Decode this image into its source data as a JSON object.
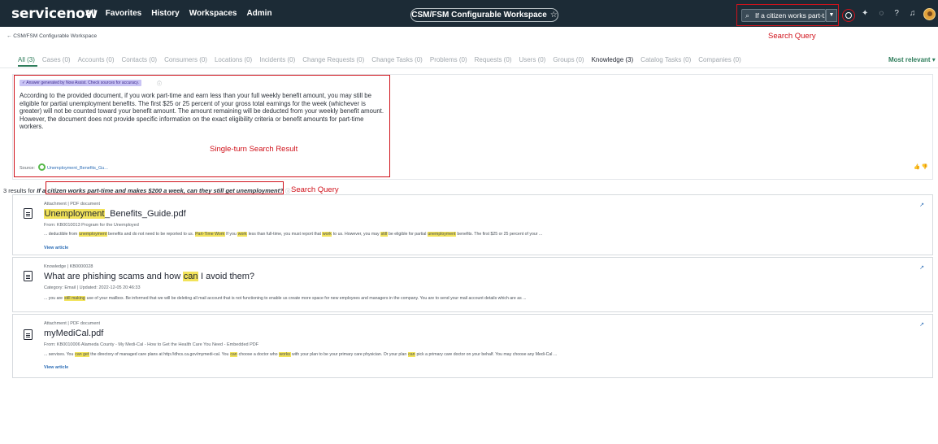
{
  "header": {
    "logo_text": "servicenow",
    "nav": [
      "All",
      "Favorites",
      "History",
      "Workspaces",
      "Admin"
    ],
    "workspace_label": "CSM/FSM Configurable Workspace",
    "workspace_star": "☆",
    "search_value": "If a citizen works part-t...",
    "search_query_annotation": "Search Query"
  },
  "breadcrumb": {
    "back": "← CSM/FSM Configurable Workspace"
  },
  "tabs": [
    {
      "label": "All (3)",
      "state": "active"
    },
    {
      "label": "Cases (0)",
      "state": "muted"
    },
    {
      "label": "Accounts (0)",
      "state": "muted"
    },
    {
      "label": "Contacts (0)",
      "state": "muted"
    },
    {
      "label": "Consumers (0)",
      "state": "muted"
    },
    {
      "label": "Locations (0)",
      "state": "muted"
    },
    {
      "label": "Incidents (0)",
      "state": "muted"
    },
    {
      "label": "Change Requests (0)",
      "state": "muted"
    },
    {
      "label": "Change Tasks (0)",
      "state": "muted"
    },
    {
      "label": "Problems (0)",
      "state": "muted"
    },
    {
      "label": "Requests (0)",
      "state": "muted"
    },
    {
      "label": "Users (0)",
      "state": "muted"
    },
    {
      "label": "Groups (0)",
      "state": "muted"
    },
    {
      "label": "Knowledge (3)",
      "state": "bold"
    },
    {
      "label": "Catalog Tasks (0)",
      "state": "muted"
    },
    {
      "label": "Companies (0)",
      "state": "muted"
    }
  ],
  "sort_label": "Most relevant ▾",
  "answer": {
    "badge": "✓ Answer generated by Now Assist. Check sources for accuracy.",
    "text": "According to the provided document, if you work part-time and earn less than your full weekly benefit amount, you may still be eligible for partial unemployment benefits. The first $25 or 25 percent of your gross total earnings for the week (whichever is greater) will not be counted toward your benefit amount. The amount remaining will be deducted from your weekly benefit amount. However, the document does not provide specific information on the exact eligibility criteria or benefit amounts for part-time workers.",
    "annotation": "Single-turn Search Result",
    "source_label": "Source:",
    "source_link": "Unemployment_Benefits_Gu..."
  },
  "results_summary": {
    "prefix": "3 results for",
    "query": "If a citizen works part-time and makes $200 a week, can they still get unemployment?",
    "annotation": "Search Query"
  },
  "results": [
    {
      "meta": "Attachment | PDF document",
      "title_parts": [
        {
          "text": "Unemployment",
          "hl": true
        },
        {
          "text": "_Benefits_Guide.pdf",
          "hl": false
        }
      ],
      "sub": "From: KB0010013 Program for the Unemployed",
      "snippet_parts": [
        {
          "text": "... deductible from ",
          "hl": false
        },
        {
          "text": "unemployment",
          "hl": true
        },
        {
          "text": " benefits and do not need to be reported to us. ",
          "hl": false
        },
        {
          "text": "Part-Time Work",
          "hl": true
        },
        {
          "text": " If you ",
          "hl": false
        },
        {
          "text": "work",
          "hl": true
        },
        {
          "text": " less than full-time, you must report that ",
          "hl": false
        },
        {
          "text": "work",
          "hl": true
        },
        {
          "text": " to us. However, you may ",
          "hl": false
        },
        {
          "text": "still",
          "hl": true
        },
        {
          "text": " be eligible for partial ",
          "hl": false
        },
        {
          "text": "unemployment",
          "hl": true
        },
        {
          "text": " benefits. The first $25 or 25 percent of your ...",
          "hl": false
        }
      ],
      "view": "View article"
    },
    {
      "meta": "Knowledge | KB0000028",
      "title_parts": [
        {
          "text": "What are phishing scams and how ",
          "hl": false
        },
        {
          "text": "can",
          "hl": true
        },
        {
          "text": " I avoid them?",
          "hl": false
        }
      ],
      "sub": "Category: Email | Updated: 2022-12-05 20:46:33",
      "snippet_parts": [
        {
          "text": "... you are ",
          "hl": false
        },
        {
          "text": "still making",
          "hl": true
        },
        {
          "text": " use of your mailbox. Be informed that we will be deleting all mail account that is not functioning to enable us create more space for new employees and managers in the company. You are to send your mail account details which are as ...",
          "hl": false
        }
      ],
      "view": ""
    },
    {
      "meta": "Attachment | PDF document",
      "title_parts": [
        {
          "text": "myMediCal.pdf",
          "hl": false
        }
      ],
      "sub": "From: KB0010006 Alameda County - My Medi-Cal - How to Get the Health Care You Need - Embedded PDF",
      "snippet_parts": [
        {
          "text": "... services. You ",
          "hl": false
        },
        {
          "text": "can get",
          "hl": true
        },
        {
          "text": " the directory of managed care plans at http://dhcs.ca.gov/mymedi-cal. You ",
          "hl": false
        },
        {
          "text": "can",
          "hl": true
        },
        {
          "text": " choose a doctor who ",
          "hl": false
        },
        {
          "text": "works",
          "hl": true
        },
        {
          "text": " with your plan to be your primary care physician. Or your plan ",
          "hl": false
        },
        {
          "text": "can",
          "hl": true
        },
        {
          "text": " pick a primary care doctor on your behalf. You may choose any Medi-Cal ...",
          "hl": false
        }
      ],
      "view": "View article"
    }
  ],
  "colors": {
    "nav_bg": "#1c2b36",
    "accent_green": "#2e7d5b",
    "annotation_red": "#d0121b",
    "highlight": "#f2e35a"
  }
}
